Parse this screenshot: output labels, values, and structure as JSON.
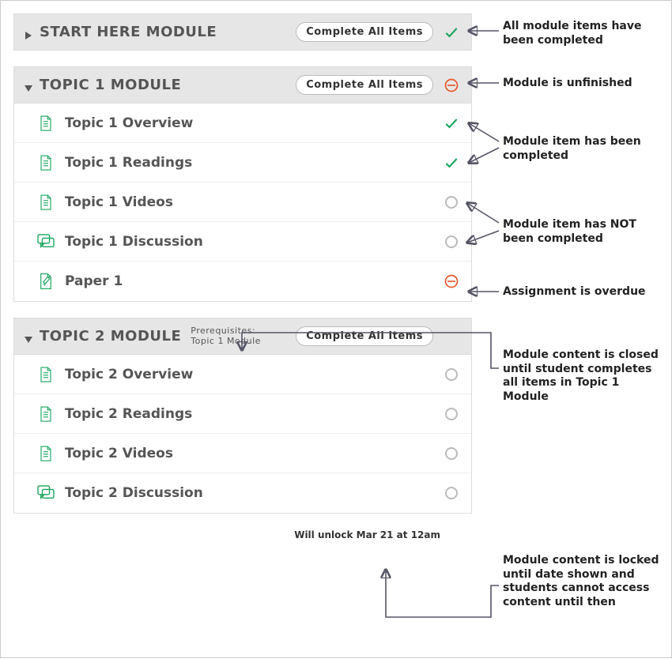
{
  "complete_label": "Complete All Items",
  "modules": {
    "0": {
      "title": "START HERE MODULE"
    },
    "1": {
      "title": "TOPIC 1 MODULE",
      "items": {
        "0": {
          "title": "Topic 1 Overview"
        },
        "1": {
          "title": "Topic 1 Readings"
        },
        "2": {
          "title": "Topic 1 Videos"
        },
        "3": {
          "title": "Topic 1 Discussion"
        },
        "4": {
          "title": "Paper 1"
        }
      }
    },
    "2": {
      "title": "TOPIC 2 MODULE",
      "prereq": "Prerequisites:\nTopic 1 Module",
      "items": {
        "0": {
          "title": "Topic 2 Overview"
        },
        "1": {
          "title": "Topic 2 Readings"
        },
        "2": {
          "title": "Topic 2 Videos"
        },
        "3": {
          "title": "Topic 2 Discussion"
        }
      },
      "unlock_note": "Will unlock Mar 21 at 12am"
    }
  },
  "annotations": {
    "all_complete": "All module items have been completed",
    "unfinished": "Module is unfinished",
    "item_done": "Module item has been completed",
    "item_not_done": "Module item has NOT been completed",
    "overdue": "Assignment is overdue",
    "prereq": "Module content is closed until student completes all items in Topic 1 Module",
    "locked": "Module content is locked until date shown and students cannot access content until then"
  }
}
